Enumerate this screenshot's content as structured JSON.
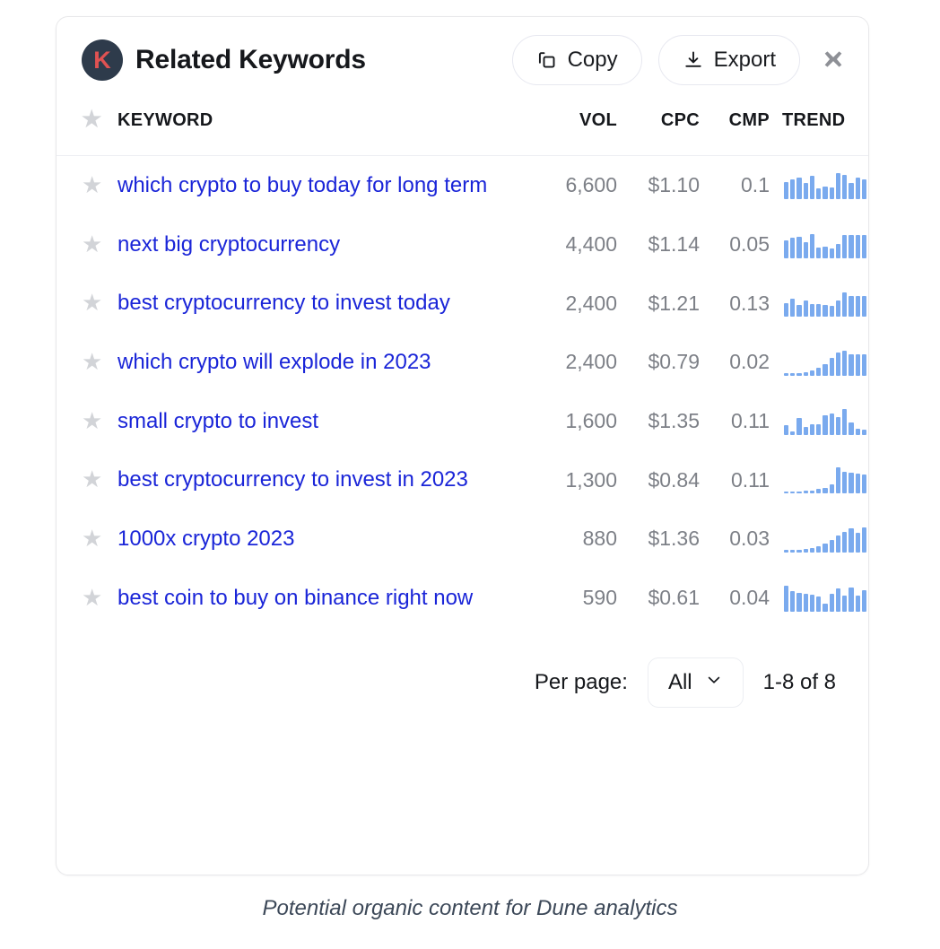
{
  "card": {
    "logo_letter": "K",
    "title": "Related Keywords",
    "copy_label": "Copy",
    "export_label": "Export"
  },
  "colors": {
    "keyword_link": "#1a25d8",
    "logo_bg": "#2e3b4b",
    "logo_text": "#e05252",
    "sparkline_bar": "#7aaaee",
    "metric_text": "#7d8087",
    "star": "#d2d4d8"
  },
  "table": {
    "columns": [
      "KEYWORD",
      "VOL",
      "CPC",
      "CMP",
      "TREND"
    ],
    "rows": [
      {
        "keyword": "which crypto to buy today for long term",
        "vol": "6,600",
        "cpc": "$1.10",
        "cmp": "0.1",
        "trend": [
          62,
          72,
          78,
          58,
          86,
          40,
          46,
          42,
          96,
          88,
          58,
          80,
          72
        ]
      },
      {
        "keyword": "next big cryptocurrency",
        "vol": "4,400",
        "cpc": "$1.14",
        "cmp": "0.05",
        "trend": [
          66,
          74,
          80,
          60,
          88,
          40,
          42,
          34,
          52,
          86,
          84,
          84,
          84
        ]
      },
      {
        "keyword": "best cryptocurrency to invest today",
        "vol": "2,400",
        "cpc": "$1.21",
        "cmp": "0.13",
        "trend": [
          52,
          66,
          44,
          60,
          46,
          48,
          44,
          42,
          62,
          92,
          78,
          78,
          76
        ]
      },
      {
        "keyword": "which crypto will explode in 2023",
        "vol": "2,400",
        "cpc": "$0.79",
        "cmp": "0.02",
        "trend": [
          8,
          8,
          10,
          12,
          20,
          30,
          44,
          66,
          86,
          92,
          78,
          80,
          80
        ]
      },
      {
        "keyword": "small crypto to invest",
        "vol": "1,600",
        "cpc": "$1.35",
        "cmp": "0.11",
        "trend": [
          34,
          12,
          62,
          30,
          40,
          38,
          72,
          78,
          64,
          96,
          46,
          22,
          18
        ]
      },
      {
        "keyword": "best cryptocurrency to invest in 2023",
        "vol": "1,300",
        "cpc": "$0.84",
        "cmp": "0.11",
        "trend": [
          8,
          8,
          8,
          10,
          12,
          16,
          22,
          34,
          96,
          80,
          76,
          74,
          72
        ]
      },
      {
        "keyword": "1000x crypto 2023",
        "vol": "880",
        "cpc": "$1.36",
        "cmp": "0.03",
        "trend": [
          8,
          8,
          10,
          12,
          16,
          24,
          34,
          46,
          62,
          76,
          88,
          72,
          92
        ]
      },
      {
        "keyword": "best coin to buy on binance right now",
        "vol": "590",
        "cpc": "$0.61",
        "cmp": "0.04",
        "trend": [
          96,
          74,
          70,
          66,
          62,
          56,
          30,
          66,
          84,
          58,
          88,
          60,
          80
        ]
      }
    ]
  },
  "footer": {
    "per_page_label": "Per page:",
    "per_page_value": "All",
    "range_text": "1-8 of 8"
  },
  "caption": "Potential organic content for Dune analytics"
}
